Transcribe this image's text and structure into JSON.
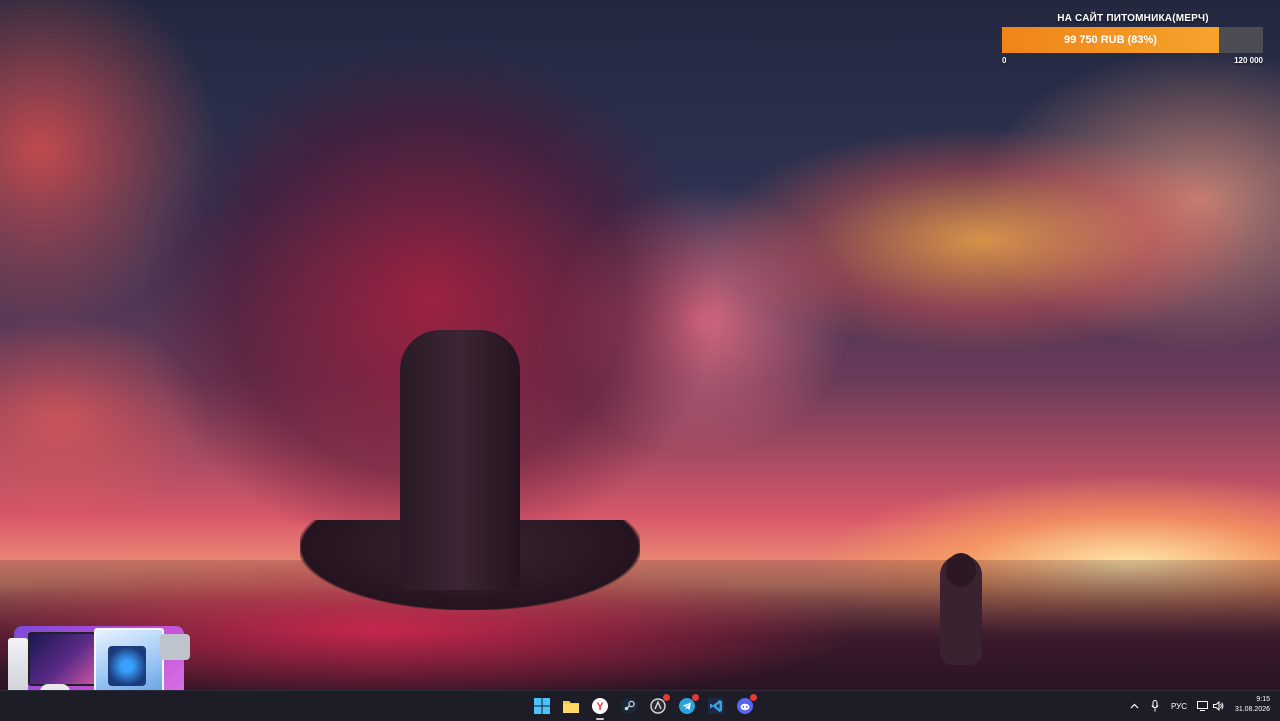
{
  "goal_widget": {
    "title": "НА САЙТ ПИТОМНИКА(МЕРЧ)",
    "amount_text": "99 750 RUB (83%)",
    "progress": 0.83,
    "min_label": "0",
    "max_label": "120 000",
    "fill_color": "#f08418"
  },
  "taskbar": {
    "apps": [
      {
        "name": "windows-start-icon",
        "active": false
      },
      {
        "name": "file-explorer-icon",
        "active": false
      },
      {
        "name": "yandex-browser-icon",
        "active": true
      },
      {
        "name": "steam-icon",
        "active": false
      },
      {
        "name": "app-icon-with-badge",
        "active": false
      },
      {
        "name": "telegram-icon",
        "active": false
      },
      {
        "name": "visual-studio-icon",
        "active": false
      },
      {
        "name": "discord-icon",
        "active": false
      }
    ],
    "tray": {
      "language": "РУС",
      "time": "9:15",
      "date": "31.08.2026"
    }
  },
  "colors": {
    "taskbar_bg": "#1c1d27",
    "accent_orange": "#f08418",
    "discord": "#5865f2",
    "telegram": "#2aa3df",
    "yandex": "#ff3333"
  }
}
